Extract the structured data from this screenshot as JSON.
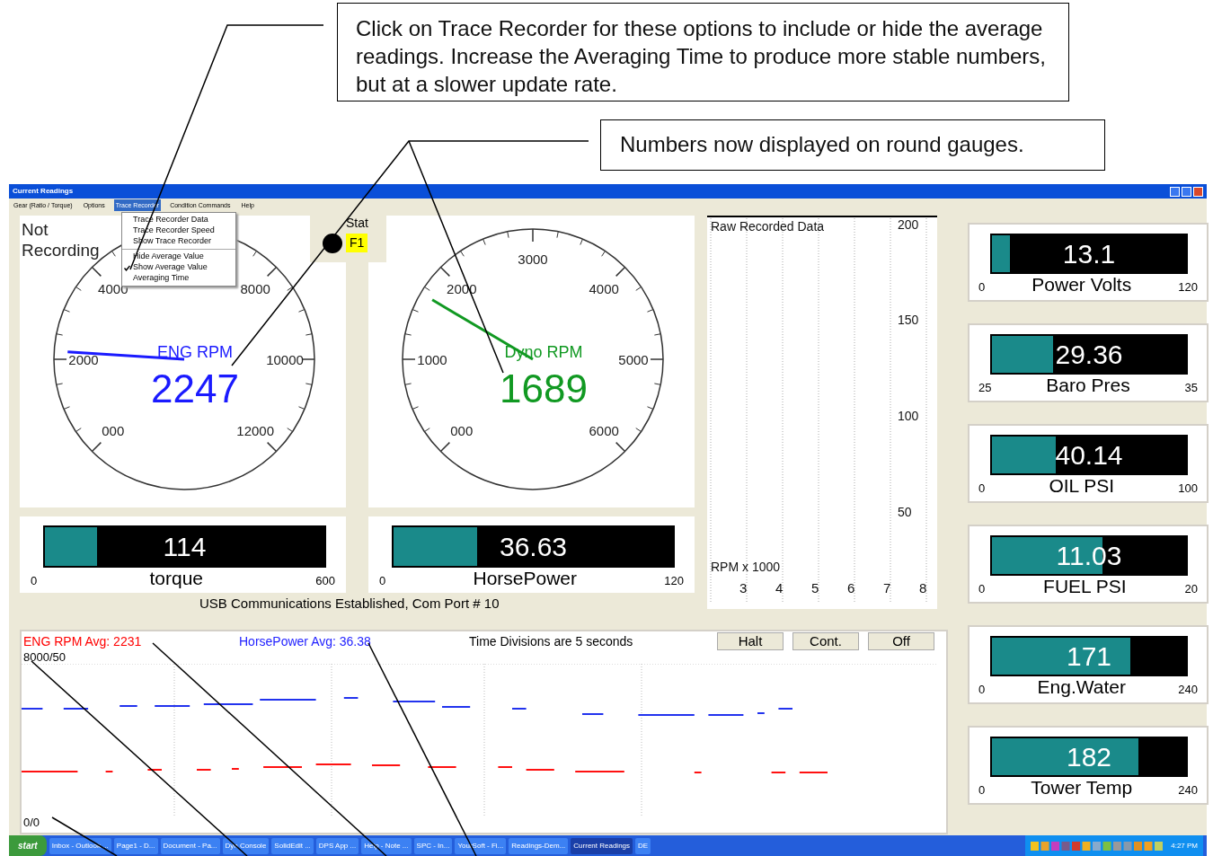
{
  "callouts": [
    {
      "text": "Click on Trace Recorder for these options to include or hide the average readings.  Increase the Averaging Time to produce more stable numbers, but at a slower update rate."
    },
    {
      "text": "Numbers now displayed on round gauges."
    }
  ],
  "window": {
    "title": "Current Readings"
  },
  "menu": [
    {
      "label": "Gear (Ratio / Torque)",
      "selected": false
    },
    {
      "label": "Options",
      "selected": false
    },
    {
      "label": "Trace Recorder",
      "selected": true
    },
    {
      "label": "Condition Commands",
      "selected": false
    },
    {
      "label": "Help",
      "selected": false
    }
  ],
  "dropdown": [
    {
      "kind": "item",
      "label": "Trace Recorder Data",
      "checked": false
    },
    {
      "kind": "item",
      "label": "Trace Recorder Speed",
      "checked": false
    },
    {
      "kind": "item",
      "label": "Show Trace Recorder",
      "checked": false
    },
    {
      "kind": "separator"
    },
    {
      "kind": "item",
      "label": "Hide Average Value",
      "checked": false
    },
    {
      "kind": "item",
      "label": "Show Average Value",
      "checked": true
    },
    {
      "kind": "item",
      "label": "Averaging Time",
      "checked": false
    }
  ],
  "recording_status": "Not Recording",
  "stat": {
    "label": "Stat",
    "key": "F1"
  },
  "gauges": [
    {
      "name": "ENG RPM",
      "value": "2247",
      "color": "#1a1aff",
      "level": 0.18,
      "labels": [
        {
          "kind": "label",
          "text": "000"
        },
        {
          "kind": "label",
          "text": "2000"
        },
        {
          "kind": "label",
          "text": "4000"
        },
        {
          "kind": "blank"
        },
        {
          "kind": "label",
          "text": "8000"
        },
        {
          "kind": "label",
          "text": "10000"
        },
        {
          "kind": "label",
          "text": "12000"
        }
      ]
    },
    {
      "name": "Dyno RPM",
      "value": "1689",
      "color": "#119922",
      "level": 0.28,
      "labels": [
        {
          "kind": "label",
          "text": "000"
        },
        {
          "kind": "label",
          "text": "1000"
        },
        {
          "kind": "label",
          "text": "2000"
        },
        {
          "kind": "label",
          "text": "3000"
        },
        {
          "kind": "label",
          "text": "4000"
        },
        {
          "kind": "label",
          "text": "5000"
        },
        {
          "kind": "label",
          "text": "6000"
        }
      ]
    }
  ],
  "bars": [
    {
      "value": "114",
      "label": "torque",
      "min": "0",
      "max": "600",
      "level": 0.19
    },
    {
      "value": "36.63",
      "label": "HorsePower",
      "min": "0",
      "max": "120",
      "level": 0.3
    }
  ],
  "status_text": "USB Communications Established, Com Port # 10",
  "raw_chart": {
    "chart_data": {
      "type": "line",
      "title": "Raw Recorded Data",
      "xlabel": "RPM x 1000",
      "xticks": [
        3,
        4,
        5,
        6,
        7,
        8
      ],
      "yticks": [
        50,
        100,
        150,
        200
      ],
      "xlim": [
        2,
        8
      ],
      "ylim": [
        0,
        204
      ],
      "grid": true
    }
  },
  "trace": {
    "eng_avg": "ENG RPM  Avg: 2231",
    "hp_avg": "HorsePower Avg: 36.38",
    "divisions": "Time Divisions are 5 seconds",
    "buttons": [
      "Halt",
      "Cont.",
      "Off"
    ],
    "top_label": "8000/50",
    "bottom_label": "0/0"
  },
  "side_gauges": [
    {
      "value": "13.1",
      "label": "Power Volts",
      "min": "0",
      "max": "120",
      "level": 0.1
    },
    {
      "value": "29.36",
      "label": "Baro Pres",
      "min": "25",
      "max": "35",
      "level": 0.32
    },
    {
      "value": "40.14",
      "label": "OIL PSI",
      "min": "0",
      "max": "100",
      "level": 0.33
    },
    {
      "value": "11.03",
      "label": "FUEL PSI",
      "min": "0",
      "max": "20",
      "level": 0.57
    },
    {
      "value": "171",
      "label": "Eng.Water",
      "min": "0",
      "max": "240",
      "level": 0.71
    },
    {
      "value": "182",
      "label": "Tower Temp",
      "min": "0",
      "max": "240",
      "level": 0.75
    }
  ],
  "taskbar": {
    "start": "start",
    "items": [
      {
        "label": "Inbox - Outlook ...",
        "selected": false
      },
      {
        "label": "Page1 - D...",
        "selected": false
      },
      {
        "label": "Document - Pa...",
        "selected": false
      },
      {
        "label": "Dyn Console",
        "selected": false
      },
      {
        "label": "SolidEdit ...",
        "selected": false
      },
      {
        "label": "DPS App ...",
        "selected": false
      },
      {
        "label": "Help - Note ...",
        "selected": false
      },
      {
        "label": "SPC - In...",
        "selected": false
      },
      {
        "label": "YourSoft - Fi...",
        "selected": false
      },
      {
        "label": "Readings-Dem...",
        "selected": false
      },
      {
        "label": "Current Readings",
        "selected": true
      },
      {
        "label": "DE",
        "selected": false
      }
    ],
    "clock": "4:27 PM"
  }
}
